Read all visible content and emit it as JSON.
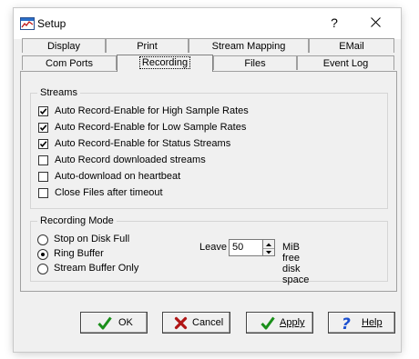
{
  "window": {
    "title": "Setup",
    "help_glyph": "?",
    "close_icon": "close-icon"
  },
  "tabs": {
    "row1": [
      {
        "label": "Display"
      },
      {
        "label": "Print"
      },
      {
        "label": "Stream Mapping"
      },
      {
        "label": "EMail"
      }
    ],
    "row2": [
      {
        "label": "Com Ports"
      },
      {
        "label": "Recording"
      },
      {
        "label": "Files"
      },
      {
        "label": "Event Log"
      }
    ],
    "active": "Recording"
  },
  "streams": {
    "label": "Streams",
    "options": [
      {
        "label": "Auto Record-Enable for High Sample Rates",
        "checked": true
      },
      {
        "label": "Auto Record-Enable for Low Sample Rates",
        "checked": true
      },
      {
        "label": "Auto Record-Enable for Status Streams",
        "checked": true
      },
      {
        "label": "Auto Record downloaded streams",
        "checked": false
      },
      {
        "label": "Auto-download on heartbeat",
        "checked": false
      },
      {
        "label": "Close Files after timeout",
        "checked": false
      }
    ]
  },
  "recording_mode": {
    "label": "Recording Mode",
    "options": [
      {
        "label": "Stop on Disk Full",
        "selected": false
      },
      {
        "label": "Ring Buffer",
        "selected": true
      },
      {
        "label": "Stream Buffer Only",
        "selected": false
      }
    ],
    "leave_label": "Leave",
    "leave_value": "50",
    "free_label": "MiB free disk space"
  },
  "buttons": {
    "ok": {
      "label": "OK",
      "icon": "checkmark-icon"
    },
    "cancel": {
      "label": "Cancel",
      "icon": "x-icon"
    },
    "apply": {
      "label": "Apply",
      "icon": "checkmark-icon"
    },
    "help": {
      "label": "Help",
      "icon": "question-icon"
    }
  },
  "colors": {
    "ok_green": "#1a8f1a",
    "cancel_red": "#b01515",
    "help_blue": "#1b4fd0"
  }
}
